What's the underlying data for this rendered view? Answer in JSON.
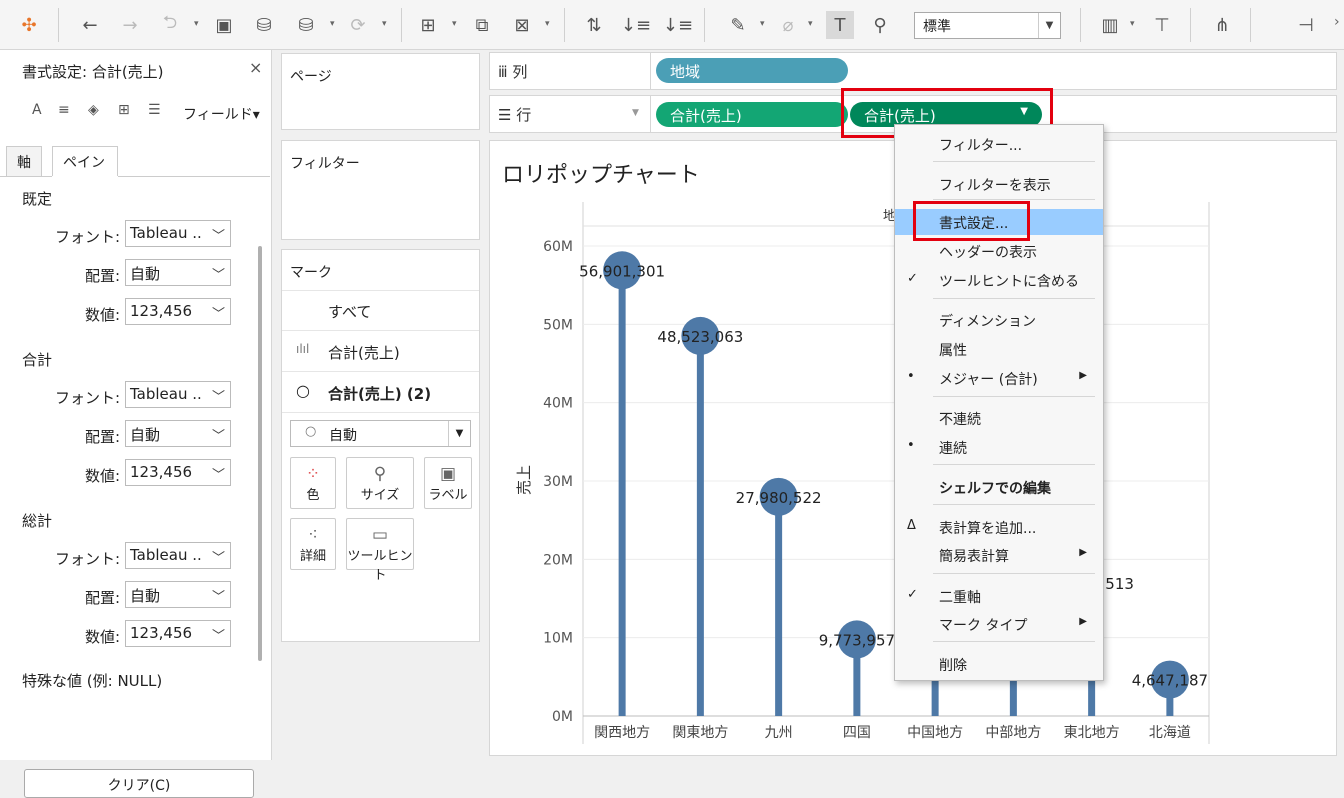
{
  "toolbar": {
    "zoom_value": "標準"
  },
  "format_pane": {
    "title": "書式設定: 合計(売上)",
    "close_glyph": "×",
    "field_dropdown": "フィールド▾",
    "tabs": [
      "軸",
      "ペイン"
    ],
    "sections": [
      {
        "name": "既定",
        "font_label": "フォント:",
        "font_value": "Tableau ..",
        "align_label": "配置:",
        "align_value": "自動",
        "number_label": "数値:",
        "number_value": "123,456"
      },
      {
        "name": "合計",
        "font_label": "フォント:",
        "font_value": "Tableau ..",
        "align_label": "配置:",
        "align_value": "自動",
        "number_label": "数値:",
        "number_value": "123,456"
      },
      {
        "name": "総計",
        "font_label": "フォント:",
        "font_value": "Tableau ..",
        "align_label": "配置:",
        "align_value": "自動",
        "number_label": "数値:",
        "number_value": "123,456"
      }
    ],
    "special_values": "特殊な値 (例: NULL)",
    "clear_button": "クリア(C)"
  },
  "pages_card": {
    "title": "ページ"
  },
  "filters_card": {
    "title": "フィルター"
  },
  "marks_card": {
    "title": "マーク",
    "rows": [
      "すべて",
      "合計(売上)",
      "合計(売上) (2)"
    ],
    "mark_type": "自動",
    "buttons": [
      "色",
      "サイズ",
      "ラベル",
      "詳細",
      "ツールヒント"
    ]
  },
  "shelves": {
    "columns_label": "列",
    "columns_pill": "地域",
    "rows_label": "行",
    "rows_pills": [
      "合計(売上)",
      "合計(売上)"
    ]
  },
  "colors": {
    "teal_pill": "#4b9fb6",
    "green_pill": "#13a674",
    "green_pill_dark": "#00875a",
    "lollipop": "#4e79a7",
    "highlight": "#99ccff",
    "red_box": "#e3000f"
  },
  "context_menu": {
    "items": [
      {
        "label": "フィルター..."
      },
      {
        "label": "フィルターを表示"
      },
      {
        "label": "書式設定...",
        "highlighted": true
      },
      {
        "label": "ヘッダーの表示"
      },
      {
        "label": "ツールヒントに含める",
        "mark": "✓"
      },
      {
        "label": "ディメンション"
      },
      {
        "label": "属性"
      },
      {
        "label": "メジャー (合計)",
        "mark": "•",
        "submenu": true
      },
      {
        "label": "不連続"
      },
      {
        "label": "連続",
        "mark": "•"
      },
      {
        "label": "シェルフでの編集",
        "bold": true
      },
      {
        "label": "表計算を追加...",
        "mark": "Δ"
      },
      {
        "label": "簡易表計算",
        "submenu": true
      },
      {
        "label": "二重軸",
        "mark": "✓"
      },
      {
        "label": "マーク タイプ",
        "submenu": true
      },
      {
        "label": "削除"
      }
    ]
  },
  "chart_data": {
    "type": "bar",
    "title": "ロリポップチャート",
    "header": "地域",
    "ylabel": "売上",
    "ylim": [
      0,
      60000000
    ],
    "yticks": [
      "0M",
      "10M",
      "20M",
      "30M",
      "40M",
      "50M",
      "60M"
    ],
    "categories": [
      "関西地方",
      "関東地方",
      "九州",
      "四国",
      "中国地方",
      "中部地方",
      "東北地方",
      "北海道"
    ],
    "values": [
      56901301,
      48523063,
      27980522,
      9773957,
      null,
      null,
      null,
      4647187
    ],
    "labels": [
      "56,901,301",
      "48,523,063",
      "27,980,522",
      "9,773,957",
      "",
      "",
      "513",
      "4,647,187"
    ],
    "mark_style": "lollipop"
  }
}
